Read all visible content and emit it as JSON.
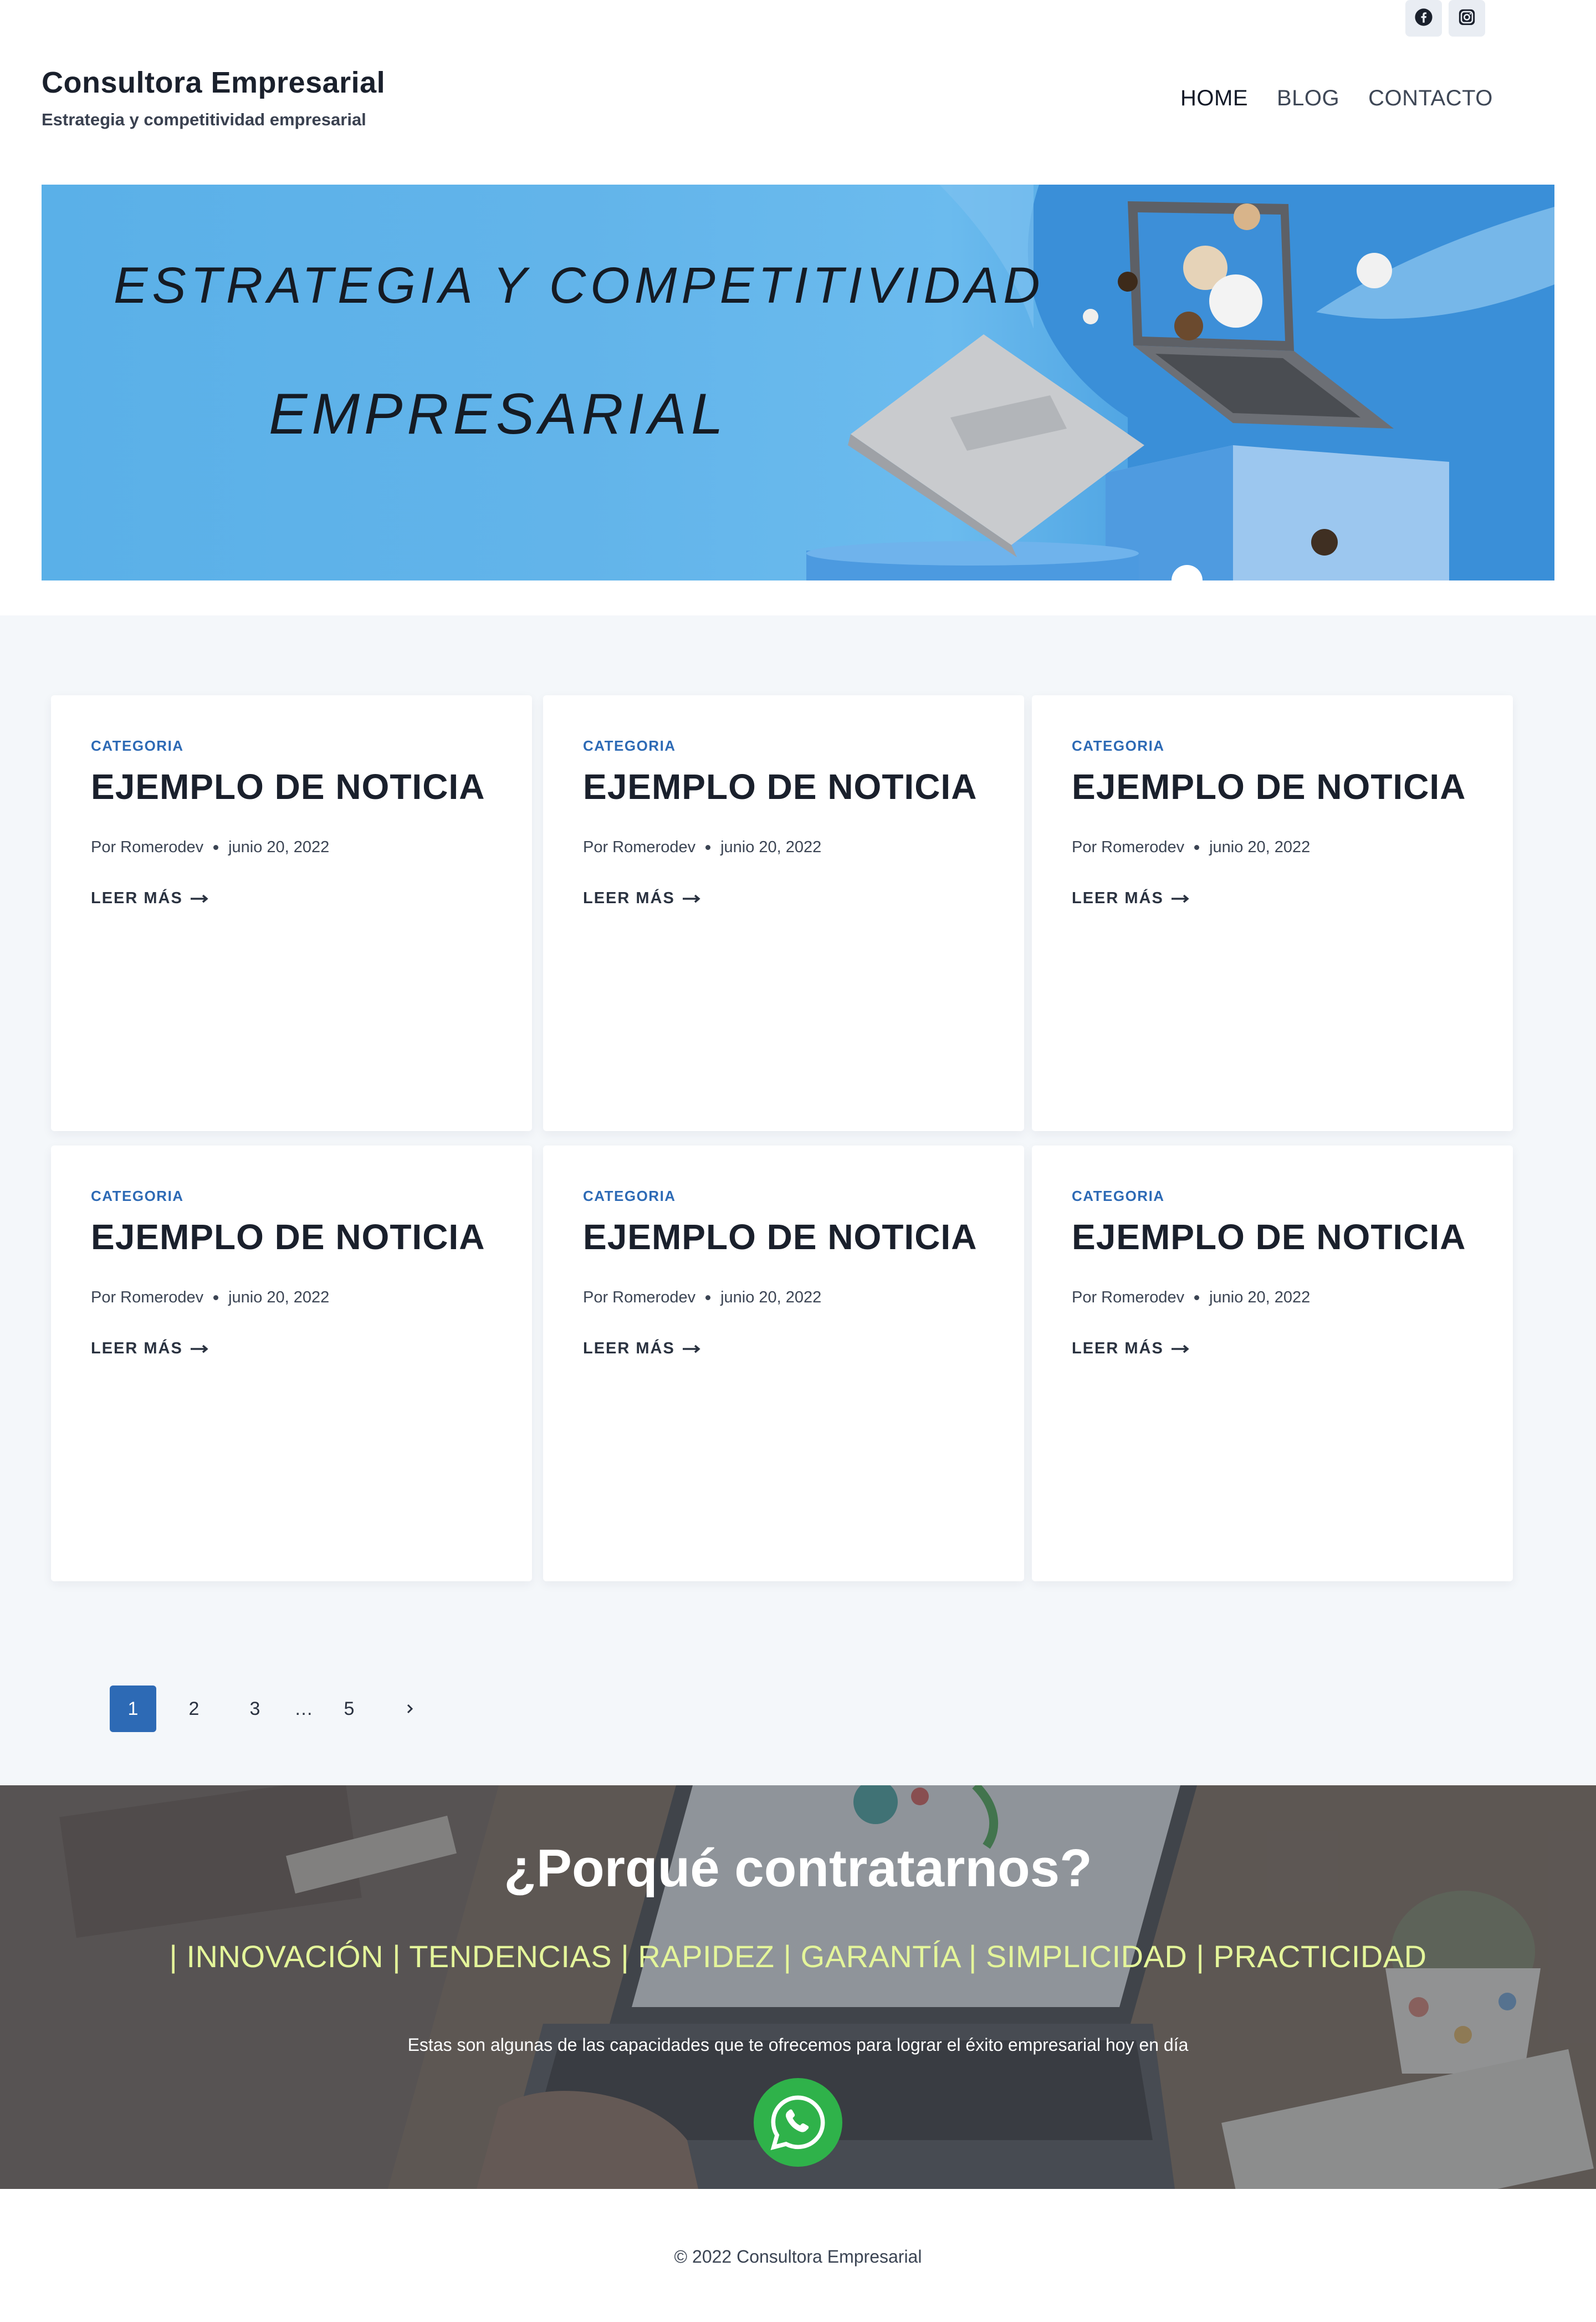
{
  "header": {
    "site_title": "Consultora Empresarial",
    "tagline": "Estrategia y competitividad empresarial",
    "social": [
      {
        "icon": "facebook-icon"
      },
      {
        "icon": "instagram-icon"
      }
    ],
    "nav": [
      {
        "label": "HOME",
        "active": true
      },
      {
        "label": "BLOG",
        "active": false
      },
      {
        "label": "CONTACTO",
        "active": false
      }
    ]
  },
  "hero": {
    "line1": "ESTRATEGIA Y COMPETITIVIDAD",
    "line2": "EMPRESARIAL"
  },
  "posts": [
    {
      "category": "CATEGORIA",
      "title": "EJEMPLO DE NOTICIA",
      "author": "Por Romerodev",
      "date": "junio 20, 2022",
      "more": "LEER MÁS"
    },
    {
      "category": "CATEGORIA",
      "title": "EJEMPLO DE NOTICIA",
      "author": "Por Romerodev",
      "date": "junio 20, 2022",
      "more": "LEER MÁS"
    },
    {
      "category": "CATEGORIA",
      "title": "EJEMPLO DE NOTICIA",
      "author": "Por Romerodev",
      "date": "junio 20, 2022",
      "more": "LEER MÁS"
    },
    {
      "category": "CATEGORIA",
      "title": "EJEMPLO DE NOTICIA",
      "author": "Por Romerodev",
      "date": "junio 20, 2022",
      "more": "LEER MÁS"
    },
    {
      "category": "CATEGORIA",
      "title": "EJEMPLO DE NOTICIA",
      "author": "Por Romerodev",
      "date": "junio 20, 2022",
      "more": "LEER MÁS"
    },
    {
      "category": "CATEGORIA",
      "title": "EJEMPLO DE NOTICIA",
      "author": "Por Romerodev",
      "date": "junio 20, 2022",
      "more": "LEER MÁS"
    }
  ],
  "pagination": {
    "pages": [
      "1",
      "2",
      "3",
      "…",
      "5"
    ],
    "current": "1",
    "next_icon": "chevron-right-icon"
  },
  "why": {
    "title": "¿Porqué contratarnos?",
    "values": "| INNOVACIÓN | TENDENCIAS | RAPIDEZ | GARANTÍA | SIMPLICIDAD | PRACTICIDAD",
    "description": "Estas son algunas de las capacidades que te ofrecemos para lograr el éxito empresarial hoy en día",
    "cta_icon": "whatsapp-icon"
  },
  "footer": {
    "copyright": "© 2022 Consultora Empresarial"
  },
  "colors": {
    "accent": "#2d6ab5",
    "values_text": "#e4f59a",
    "whatsapp": "#2fb24a",
    "section_bg": "#f4f7fa"
  }
}
